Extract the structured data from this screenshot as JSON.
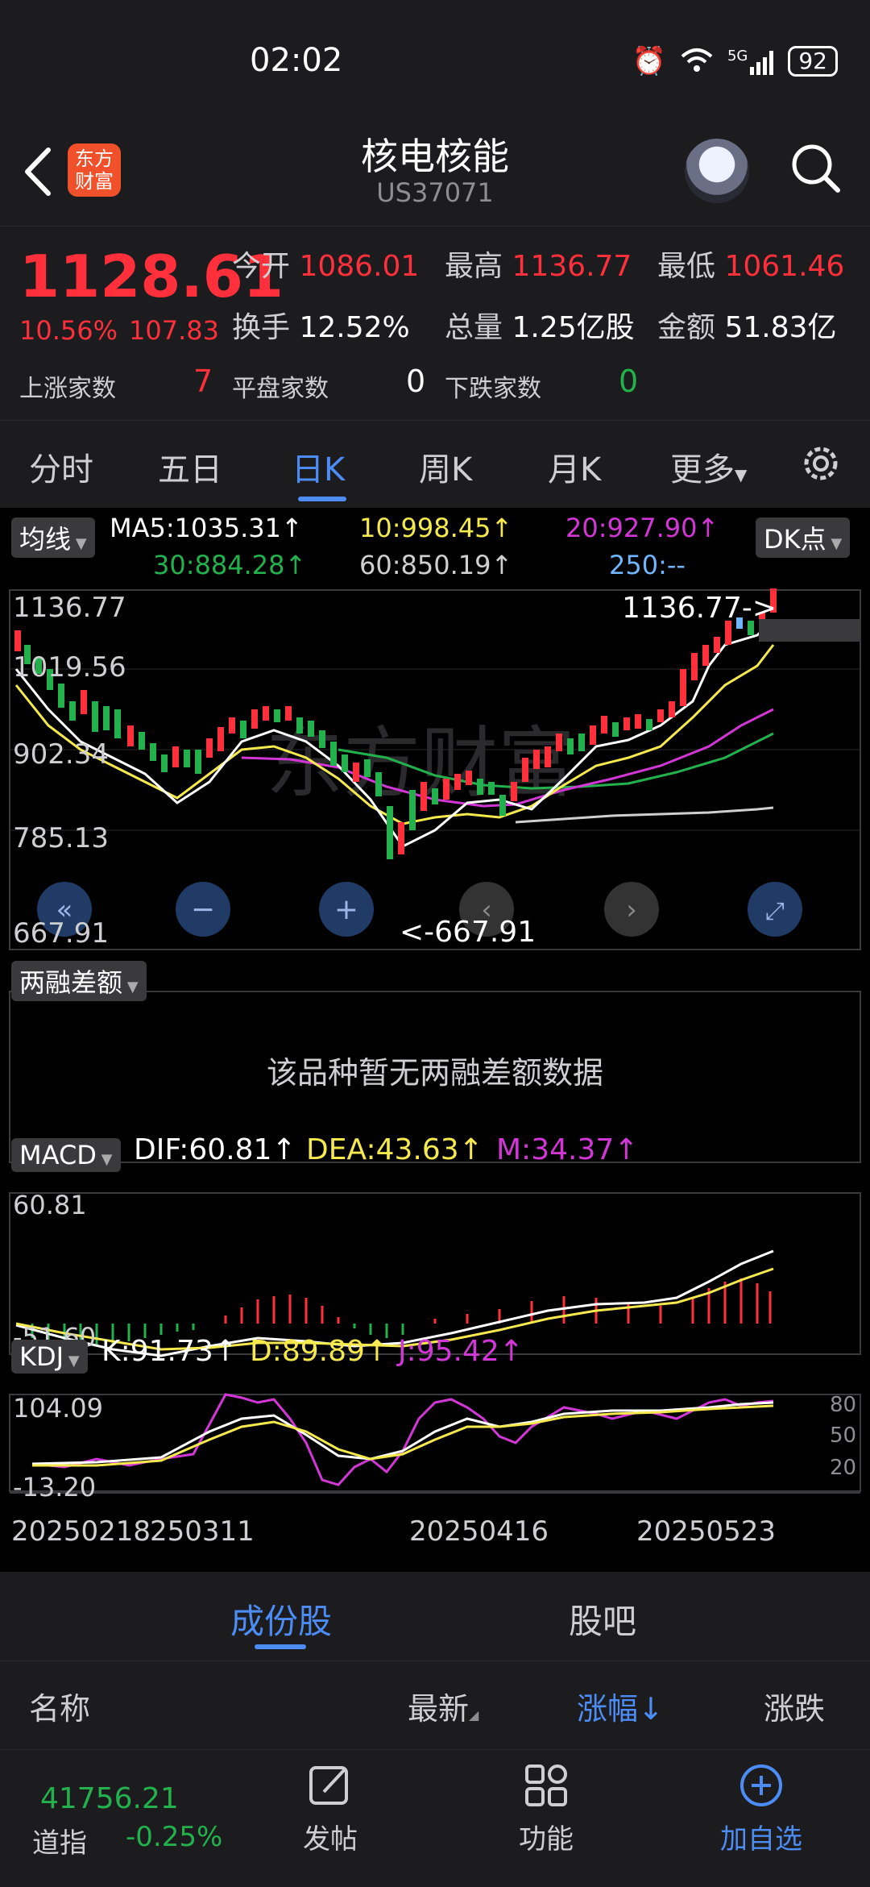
{
  "status": {
    "time": "02:02",
    "battery": "92",
    "network": "5G"
  },
  "header": {
    "title": "核电核能",
    "code": "US37071",
    "logo_line1": "东方",
    "logo_line2": "财富"
  },
  "quote": {
    "price": "1128.61",
    "pct": "10.56%",
    "change": "107.83",
    "open_label": "今开",
    "open": "1086.01",
    "high_label": "最高",
    "high": "1136.77",
    "low_label": "最低",
    "low": "1061.46",
    "turnover_label": "换手",
    "turnover": "12.52%",
    "volume_label": "总量",
    "volume": "1.25亿股",
    "amount_label": "金额",
    "amount": "51.83亿",
    "up_label": "上涨家数",
    "up": "7",
    "flat_label": "平盘家数",
    "flat": "0",
    "down_label": "下跌家数",
    "down": "0"
  },
  "tabs": [
    {
      "label": "分时"
    },
    {
      "label": "五日"
    },
    {
      "label": "日K"
    },
    {
      "label": "周K"
    },
    {
      "label": "月K"
    },
    {
      "label": "更多"
    }
  ],
  "kchart": {
    "ma_button": "均线",
    "ma5": "MA5:1035.31↑",
    "ma10": "10:998.45↑",
    "ma20": "20:927.90↑",
    "ma30": "30:884.28↑",
    "ma60": "60:850.19↑",
    "ma250": "250:--",
    "dk_button": "DK点",
    "y_labels": [
      "1136.77",
      "1019.56",
      "902.34",
      "785.13",
      "667.91"
    ],
    "max_marker": "1136.77->",
    "min_marker": "<-667.91",
    "watermark": "东方财富"
  },
  "margin": {
    "button": "两融差额",
    "empty_text": "该品种暂无两融差额数据"
  },
  "macd": {
    "button": "MACD",
    "dif": "DIF:60.81↑",
    "dea": "DEA:43.63↑",
    "m": "M:34.37↑",
    "y_top": "60.81",
    "y_bottom": "-51.60"
  },
  "kdj": {
    "button": "KDJ",
    "k": "K:91.73↑",
    "d": "D:89.89↑",
    "j": "J:95.42↑",
    "y_top": "104.09",
    "y_bottom": "-13.20",
    "levels": [
      "80",
      "50",
      "20"
    ]
  },
  "dates": [
    "20250218",
    "250311",
    "20250416",
    "20250523"
  ],
  "bottom_tabs": [
    {
      "label": "成份股"
    },
    {
      "label": "股吧"
    }
  ],
  "columns": {
    "name": "名称",
    "latest": "最新",
    "pct": "涨幅↓",
    "chg": "涨跌"
  },
  "footer": {
    "index_value": "41756.21",
    "index_name": "道指",
    "index_pct": "-0.25%",
    "post": "发帖",
    "func": "功能",
    "add": "加自选"
  },
  "colors": {
    "up": "#ff2f3b",
    "down": "#22b14c",
    "accent": "#4d8cf5",
    "ma5": "#ffffff",
    "ma10": "#f5e94d",
    "ma20": "#d336d6",
    "ma30": "#22b14c",
    "ma60": "#cfcfcf",
    "ma250": "#6fb5ff"
  }
}
